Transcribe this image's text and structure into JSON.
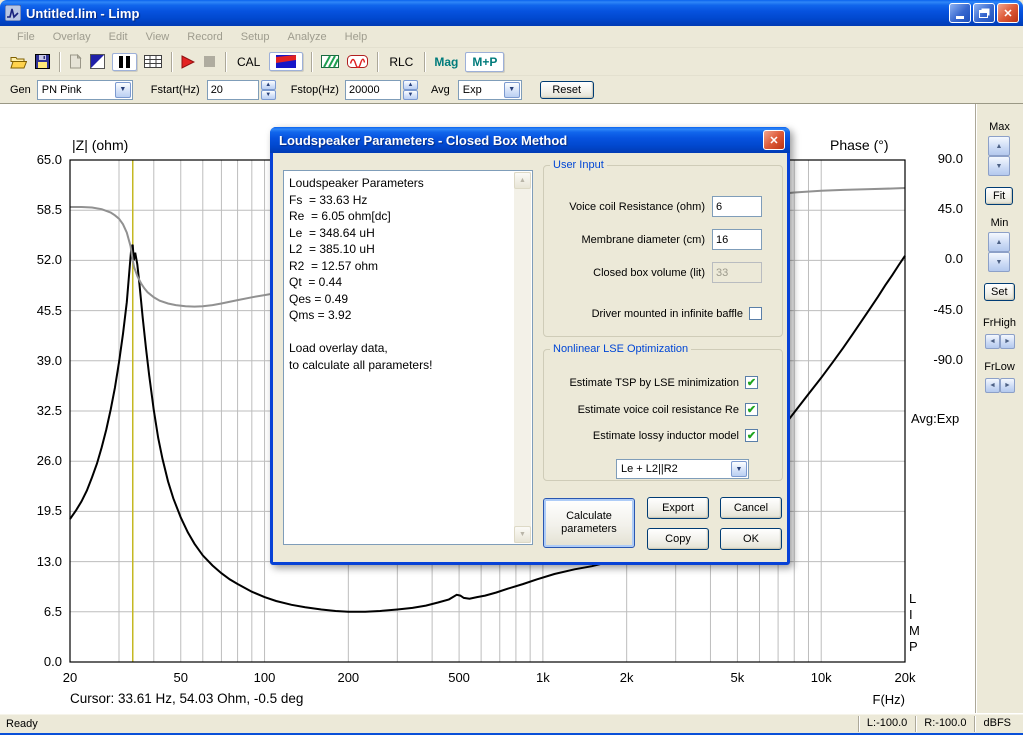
{
  "window": {
    "title": "Untitled.lim - Limp"
  },
  "menu": {
    "items": [
      "File",
      "Overlay",
      "Edit",
      "View",
      "Record",
      "Setup",
      "Analyze",
      "Help"
    ]
  },
  "toolbar": {
    "cal_label": "CAL",
    "rlc_label": "RLC",
    "mag_label": "Mag",
    "mp_label": "M+P"
  },
  "controls": {
    "gen_label": "Gen",
    "gen_value": "PN Pink",
    "fstart_label": "Fstart(Hz)",
    "fstart_value": "20",
    "fstop_label": "Fstop(Hz)",
    "fstop_value": "20000",
    "avg_label": "Avg",
    "avg_value": "Exp",
    "reset_label": "Reset"
  },
  "side_panel": {
    "max_label": "Max",
    "fit_label": "Fit",
    "min_label": "Min",
    "set_label": "Set",
    "frhigh_label": "FrHigh",
    "frlow_label": "FrLow"
  },
  "chart_data": {
    "type": "line",
    "title_left": "|Z| (ohm)",
    "title_right": "Phase (°)",
    "xlabel": "F(Hz)",
    "x_scale": "log",
    "x_range": [
      20,
      20000
    ],
    "y_left_range": [
      0,
      65
    ],
    "y_left_ticks": [
      "65.0",
      "58.5",
      "52.0",
      "45.5",
      "39.0",
      "32.5",
      "26.0",
      "19.5",
      "13.0",
      "6.5",
      "0.0"
    ],
    "y_right_ticks": [
      "90.0",
      "45.0",
      "0.0",
      "-45.0",
      "-90.0"
    ],
    "x_ticks": [
      {
        "f": 20,
        "label": "20"
      },
      {
        "f": 50,
        "label": "50"
      },
      {
        "f": 100,
        "label": "100"
      },
      {
        "f": 200,
        "label": "200"
      },
      {
        "f": 500,
        "label": "500"
      },
      {
        "f": 1000,
        "label": "1k"
      },
      {
        "f": 2000,
        "label": "2k"
      },
      {
        "f": 5000,
        "label": "5k"
      },
      {
        "f": 10000,
        "label": "10k"
      },
      {
        "f": 20000,
        "label": "20k"
      }
    ],
    "x_grid": [
      30,
      40,
      50,
      60,
      70,
      80,
      90,
      100,
      200,
      300,
      400,
      500,
      600,
      700,
      800,
      900,
      1000,
      2000,
      3000,
      4000,
      5000,
      6000,
      7000,
      8000,
      9000,
      10000
    ],
    "grid_color": "#BDBDBD",
    "cursor_hz": 33.61,
    "cursor_color": "#C5B822",
    "cursor_text": "Cursor: 33.61 Hz, 54.03 Ohm, -0.5 deg",
    "avg_indicator": "Avg:Exp",
    "watermark": "LIMP",
    "series": [
      {
        "name": "impedance",
        "axis": "left",
        "color": "#000000",
        "points": [
          [
            20,
            18.5
          ],
          [
            21,
            19.6
          ],
          [
            22,
            20.8
          ],
          [
            23,
            22.2
          ],
          [
            24,
            23.9
          ],
          [
            25,
            25.7
          ],
          [
            26,
            27.8
          ],
          [
            27,
            30.1
          ],
          [
            28,
            32.7
          ],
          [
            29,
            35.5
          ],
          [
            30,
            38.8
          ],
          [
            31,
            42.5
          ],
          [
            32,
            46.6
          ],
          [
            32.6,
            50.2
          ],
          [
            33.2,
            53.6
          ],
          [
            33.61,
            54.03
          ],
          [
            33.9,
            52.0
          ],
          [
            34.3,
            53.0
          ],
          [
            34.9,
            51.5
          ],
          [
            35.5,
            49.0
          ],
          [
            36.5,
            44.6
          ],
          [
            37.5,
            40.6
          ],
          [
            38.5,
            37.1
          ],
          [
            40,
            32.6
          ],
          [
            41.5,
            29.0
          ],
          [
            43,
            26.3
          ],
          [
            45,
            23.4
          ],
          [
            47,
            21.2
          ],
          [
            50,
            18.7
          ],
          [
            53,
            16.8
          ],
          [
            56,
            15.3
          ],
          [
            60,
            13.8
          ],
          [
            65,
            12.5
          ],
          [
            70,
            11.5
          ],
          [
            75,
            10.7
          ],
          [
            80,
            10.1
          ],
          [
            90,
            9.1
          ],
          [
            100,
            8.4
          ],
          [
            110,
            7.9
          ],
          [
            125,
            7.4
          ],
          [
            140,
            7.1
          ],
          [
            160,
            6.8
          ],
          [
            180,
            6.6
          ],
          [
            200,
            6.5
          ],
          [
            230,
            6.5
          ],
          [
            260,
            6.6
          ],
          [
            300,
            6.8
          ],
          [
            340,
            7.0
          ],
          [
            380,
            7.3
          ],
          [
            420,
            7.7
          ],
          [
            460,
            8.1
          ],
          [
            490,
            8.7
          ],
          [
            505,
            8.6
          ],
          [
            520,
            8.3
          ],
          [
            545,
            8.2
          ],
          [
            580,
            8.4
          ],
          [
            620,
            8.6
          ],
          [
            680,
            9.0
          ],
          [
            750,
            9.5
          ],
          [
            850,
            10.1
          ],
          [
            950,
            10.7
          ],
          [
            1100,
            11.4
          ],
          [
            1300,
            12.0
          ],
          [
            1500,
            12.4
          ],
          [
            1750,
            13.0
          ],
          [
            2000,
            13.8
          ],
          [
            2500,
            15.2
          ],
          [
            3000,
            16.8
          ],
          [
            3500,
            18.4
          ],
          [
            4000,
            20.1
          ],
          [
            4500,
            21.8
          ],
          [
            5000,
            23.4
          ],
          [
            5500,
            25.0
          ],
          [
            6000,
            26.6
          ],
          [
            6500,
            28.1
          ],
          [
            7000,
            29.6
          ],
          [
            7500,
            31.0
          ],
          [
            8000,
            32.3
          ],
          [
            9000,
            34.7
          ],
          [
            10000,
            36.8
          ],
          [
            11000,
            38.8
          ],
          [
            12000,
            40.7
          ],
          [
            13000,
            42.5
          ],
          [
            14000,
            44.2
          ],
          [
            15000,
            45.8
          ],
          [
            16000,
            47.3
          ],
          [
            17000,
            48.8
          ],
          [
            18000,
            50.1
          ],
          [
            19000,
            51.4
          ],
          [
            20000,
            52.6
          ]
        ]
      },
      {
        "name": "phase",
        "axis": "right",
        "color": "#919191",
        "points": [
          [
            20,
            47
          ],
          [
            22,
            47
          ],
          [
            24,
            46.5
          ],
          [
            26,
            45
          ],
          [
            28,
            42
          ],
          [
            29,
            39.5
          ],
          [
            30,
            36.5
          ],
          [
            31,
            31.5
          ],
          [
            32,
            24
          ],
          [
            33,
            12
          ],
          [
            33.61,
            -0.5
          ],
          [
            34,
            -7
          ],
          [
            35,
            -15.5
          ],
          [
            36,
            -21.5
          ],
          [
            37,
            -26
          ],
          [
            38,
            -29.5
          ],
          [
            40,
            -34
          ],
          [
            42,
            -37
          ],
          [
            45,
            -39.5
          ],
          [
            48,
            -41
          ],
          [
            52,
            -42
          ],
          [
            56,
            -42.3
          ],
          [
            60,
            -42
          ],
          [
            65,
            -41
          ],
          [
            70,
            -39.5
          ],
          [
            80,
            -36.5
          ],
          [
            90,
            -34
          ],
          [
            100,
            -32
          ],
          [
            120,
            -28.5
          ],
          [
            150,
            -23.5
          ],
          [
            200,
            -16.5
          ],
          [
            300,
            -6.5
          ],
          [
            400,
            1.5
          ],
          [
            500,
            7.5
          ],
          [
            700,
            17
          ],
          [
            1000,
            26
          ],
          [
            1500,
            35
          ],
          [
            2000,
            41
          ],
          [
            3000,
            48
          ],
          [
            4000,
            52
          ],
          [
            5000,
            55
          ],
          [
            6000,
            57
          ],
          [
            7000,
            58.5
          ],
          [
            8000,
            60
          ],
          [
            10000,
            61.5
          ],
          [
            12000,
            62.3
          ],
          [
            15000,
            63
          ],
          [
            18000,
            63.6
          ],
          [
            20000,
            64
          ]
        ]
      }
    ]
  },
  "dialog": {
    "title": "Loudspeaker Parameters - Closed Box Method",
    "results_text": "Loudspeaker Parameters\nFs  = 33.63 Hz\nRe  = 6.05 ohm[dc]\nLe  = 348.64 uH\nL2  = 385.10 uH\nR2  = 12.57 ohm\nQt  = 0.44\nQes = 0.49\nQms = 3.92\n\nLoad overlay data,\nto calculate all parameters!",
    "user_input": {
      "title": "User Input",
      "fields": [
        {
          "label": "Voice coil Resistance (ohm)",
          "value": "6",
          "disabled": false
        },
        {
          "label": "Membrane diameter (cm)",
          "value": "16",
          "disabled": false
        },
        {
          "label": "Closed box volume (lit)",
          "value": "33",
          "disabled": true
        }
      ],
      "checkbox_label": "Driver mounted in infinite baffle",
      "checkbox_checked": false
    },
    "lse": {
      "title": "Nonlinear LSE Optimization",
      "checkboxes": [
        {
          "label": "Estimate TSP by LSE minimization",
          "checked": true
        },
        {
          "label": "Estimate voice coil resistance Re",
          "checked": true
        },
        {
          "label": "Estimate lossy inductor model",
          "checked": true
        }
      ],
      "model_value": "Le + L2||R2"
    },
    "buttons": {
      "calculate": "Calculate parameters",
      "export": "Export",
      "copy": "Copy",
      "cancel": "Cancel",
      "ok": "OK"
    }
  },
  "status": {
    "left": "Ready",
    "l": "L:-100.0",
    "r": "R:-100.0",
    "unit": "dBFS"
  }
}
